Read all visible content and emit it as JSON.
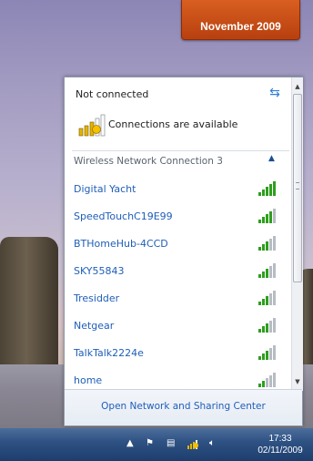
{
  "calendar": {
    "label": "November 2009"
  },
  "flyout": {
    "status_title": "Not connected",
    "available_text": "Connections are available",
    "group_label": "Wireless Network Connection 3",
    "networks": [
      {
        "name": "Digital Yacht",
        "signal": 5
      },
      {
        "name": "SpeedTouchC19E99",
        "signal": 4
      },
      {
        "name": "BTHomeHub-4CCD",
        "signal": 3
      },
      {
        "name": "SKY55843",
        "signal": 3
      },
      {
        "name": "Tresidder",
        "signal": 3
      },
      {
        "name": "Netgear",
        "signal": 3
      },
      {
        "name": "TalkTalk2224e",
        "signal": 3
      },
      {
        "name": "home",
        "signal": 2
      }
    ],
    "footer_link": "Open Network and Sharing Center"
  },
  "taskbar": {
    "time": "17:33",
    "date": "02/11/2009"
  },
  "colors": {
    "signal_active": "#2f9e1f",
    "signal_inactive": "#b7bcc4",
    "link": "#1f5eb8"
  }
}
